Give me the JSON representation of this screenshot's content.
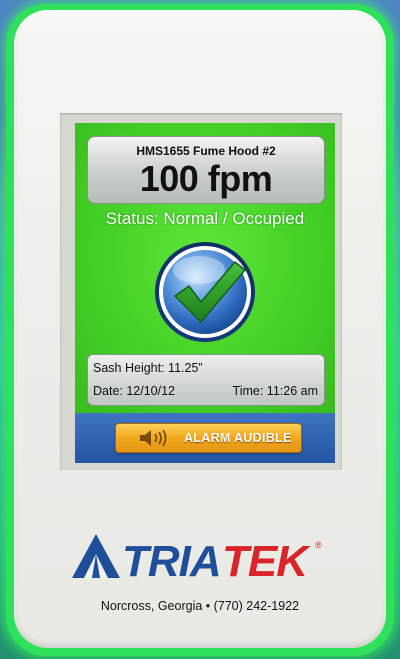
{
  "display": {
    "device_name": "HMS1655 Fume Hood #2",
    "flow_value": "100 fpm",
    "status": "Status: Normal / Occupied",
    "sash_height": "Sash Height: 11.25”",
    "date": "Date: 12/10/12",
    "time": "Time: 11:26 am",
    "alarm_label": "ALARM AUDIBLE"
  },
  "brand": {
    "logo_text": "TRIATEK",
    "registered_mark": "®",
    "address": "Norcross, Georgia • (770) 242-1922"
  },
  "colors": {
    "screen_green": "#4fd42e",
    "alarm_bar_blue": "#2354a5",
    "alarm_button_orange": "#f2a81c",
    "logo_blue": "#1f4f9b",
    "logo_red": "#d8242a"
  },
  "icons": {
    "status": "checkmark-icon",
    "alarm": "speaker-icon"
  }
}
